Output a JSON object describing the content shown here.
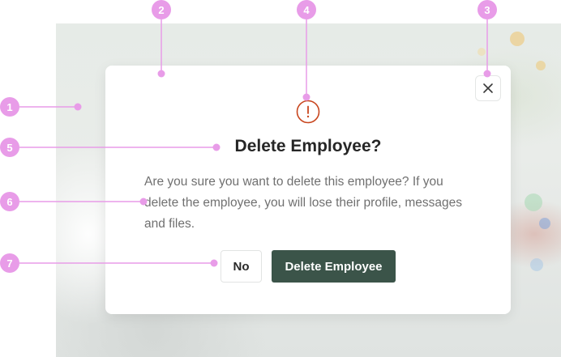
{
  "modal": {
    "title": "Delete Employee?",
    "message": "Are you sure you want to delete this employee? If you delete the employee, you will lose their profile, messages and files.",
    "no_label": "No",
    "delete_label": "Delete Employee",
    "warning_icon": "exclamation-circle-icon",
    "close_icon": "close-icon"
  },
  "annotations": {
    "markers": [
      "1",
      "2",
      "3",
      "4",
      "5",
      "6",
      "7"
    ]
  },
  "colors": {
    "annotation": "#e89ce8",
    "primary_button": "#3b5449",
    "warning": "#c8461e",
    "title": "#262626",
    "body_text": "#707070"
  }
}
